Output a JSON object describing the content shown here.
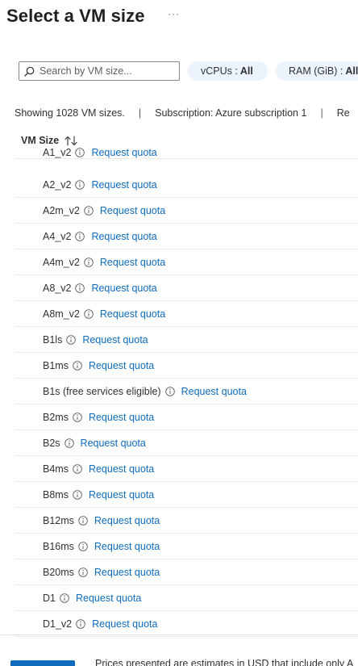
{
  "header": {
    "title": "Select a VM size",
    "more_label": "···"
  },
  "search": {
    "placeholder": "Search by VM size..."
  },
  "filters": {
    "vcpus": {
      "label": "vCPUs :",
      "value": "All"
    },
    "ram": {
      "label": "RAM (GiB) :",
      "value": "All"
    }
  },
  "info_bar": {
    "showing": "Showing 1028 VM sizes.",
    "separator": "|",
    "subscription": "Subscription: Azure subscription 1",
    "truncated": "Re"
  },
  "table": {
    "column_header": "VM Size",
    "quota_link": "Request quota",
    "rows": [
      "A1_v2",
      "A2_v2",
      "A2m_v2",
      "A4_v2",
      "A4m_v2",
      "A8_v2",
      "A8m_v2",
      "B1ls",
      "B1ms",
      "B1s (free services eligible)",
      "B2ms",
      "B2s",
      "B4ms",
      "B8ms",
      "B12ms",
      "B16ms",
      "B20ms",
      "D1",
      "D1_v2"
    ]
  },
  "footer": {
    "note": "Prices presented are estimates in USD that include only A"
  },
  "colors": {
    "link": "#0f6cbd",
    "pill_bg": "#ebf3fc",
    "primary": "#0f6cbd"
  }
}
